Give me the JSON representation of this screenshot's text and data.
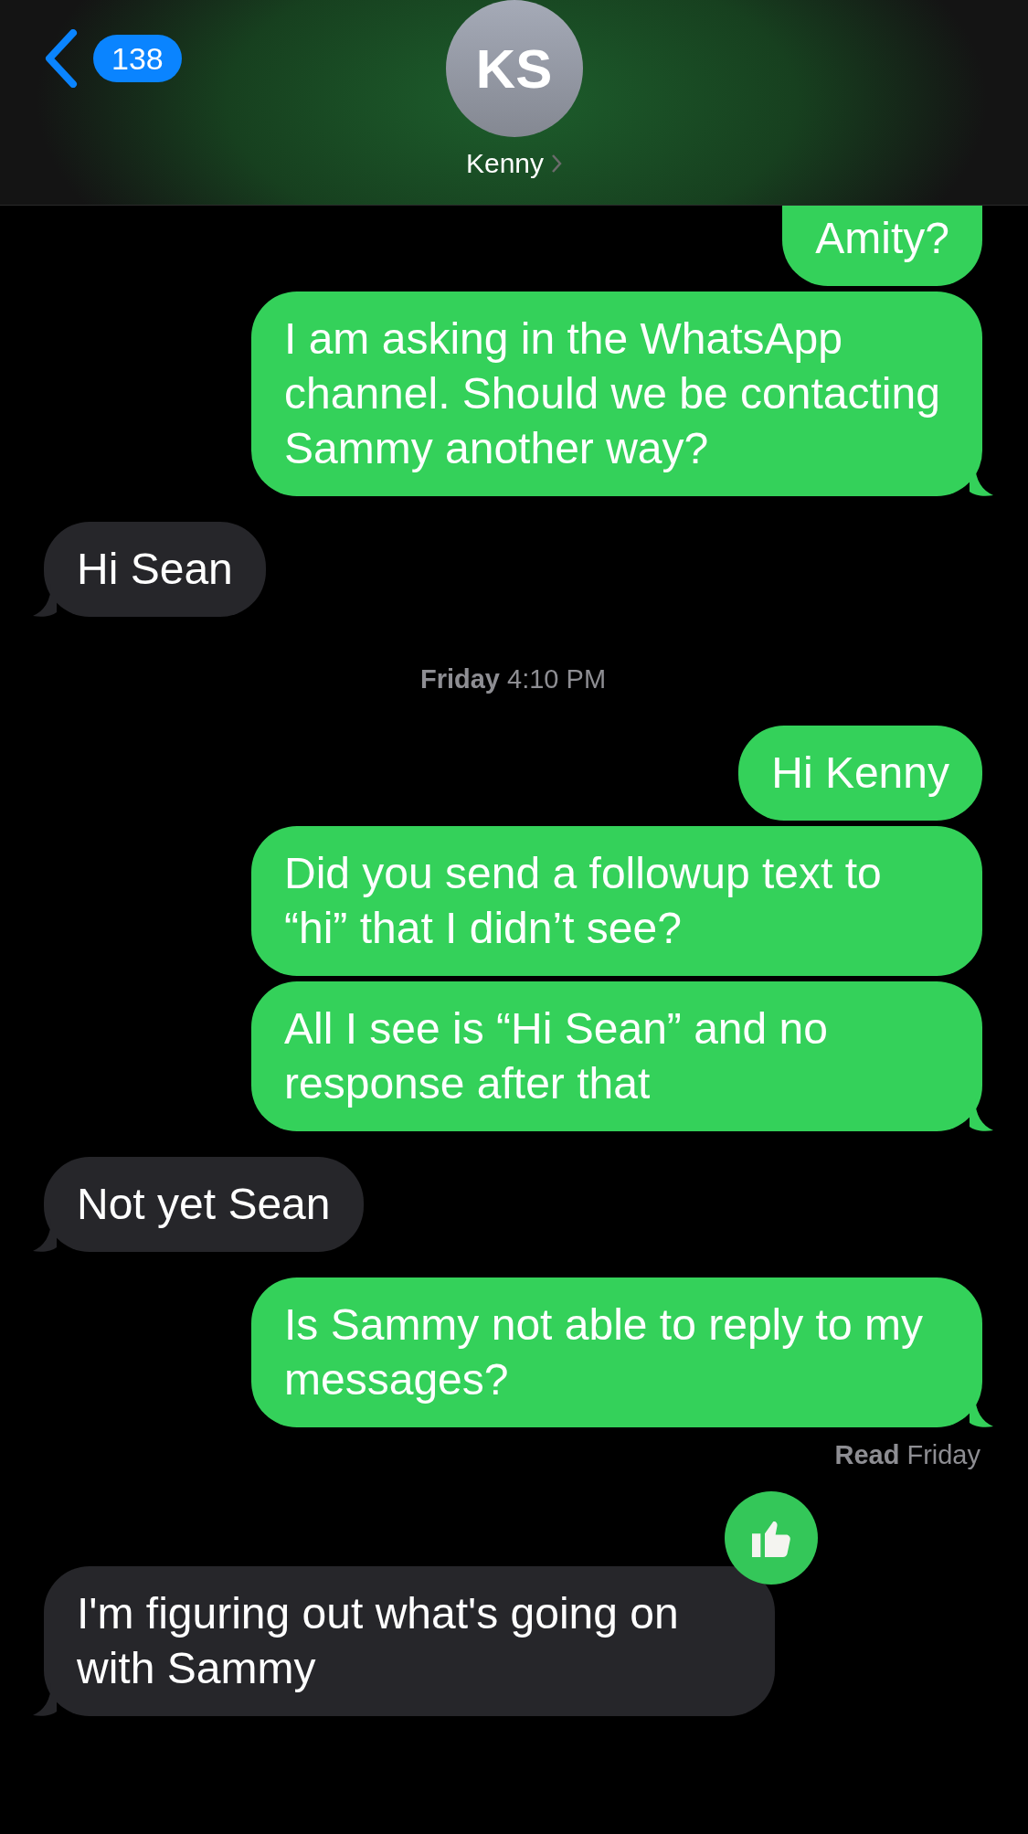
{
  "header": {
    "back_count": "138",
    "avatar_initials": "KS",
    "contact_name": "Kenny"
  },
  "messages": [
    {
      "kind": "sent",
      "text": "Amity?",
      "tail": false,
      "cut_top": true
    },
    {
      "kind": "sent",
      "text": "I am asking in the WhatsApp channel. Should we be contacting Sammy another way?",
      "tail": true
    },
    {
      "kind": "received",
      "text": "Hi Sean",
      "tail": true
    },
    {
      "kind": "timestamp",
      "text": "**Friday** 4:10 PM"
    },
    {
      "kind": "sent",
      "text": "Hi Kenny",
      "tail": false
    },
    {
      "kind": "sent",
      "text": "Did you send a followup text to “hi” that I didn’t see?",
      "tail": false
    },
    {
      "kind": "sent",
      "text": "All I see is “Hi Sean” and no response after that",
      "tail": true
    },
    {
      "kind": "received",
      "text": "Not yet Sean",
      "tail": true
    },
    {
      "kind": "sent",
      "text": "Is Sammy not able to reply to my messages?",
      "tail": true
    },
    {
      "kind": "receipt",
      "text": "**Read** Friday"
    },
    {
      "kind": "received",
      "text": "I'm figuring out what's going on with Sammy",
      "tail": true,
      "tapback": {
        "kind": "thumbs-up"
      }
    }
  ]
}
